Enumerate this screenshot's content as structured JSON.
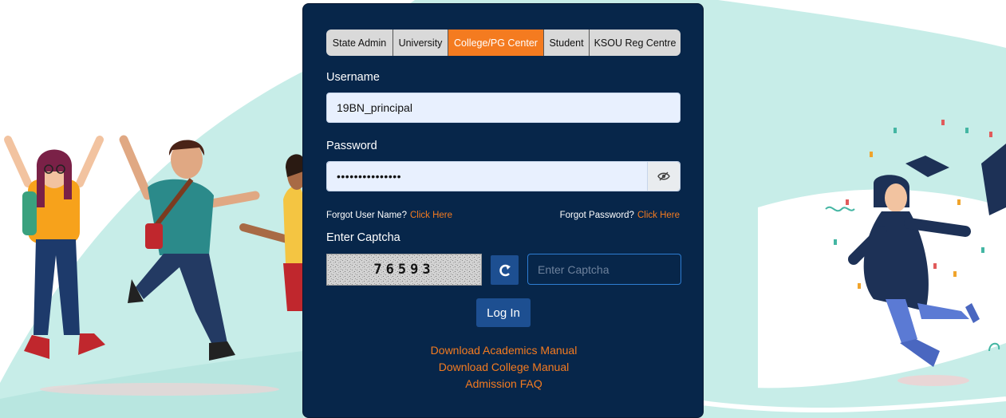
{
  "tabs": [
    {
      "label": "State Admin",
      "active": false
    },
    {
      "label": "University",
      "active": false
    },
    {
      "label": "College/PG Center",
      "active": true
    },
    {
      "label": "Student",
      "active": false
    },
    {
      "label": "KSOU Reg Centre",
      "active": false
    }
  ],
  "username": {
    "label": "Username",
    "value": "19BN_principal"
  },
  "password": {
    "label": "Password",
    "value": "•••••••••••••••",
    "toggle_icon": "eye-slash-icon"
  },
  "forgot_username": {
    "text": "Forgot User Name?",
    "link": "Click Here"
  },
  "forgot_password": {
    "text": "Forgot Password?",
    "link": "Click Here"
  },
  "captcha": {
    "label": "Enter Captcha",
    "code": "76593",
    "placeholder": "Enter Captcha",
    "refresh_icon": "refresh-icon"
  },
  "login_button": "Log In",
  "links": [
    "Download Academics Manual",
    "Download College Manual",
    "Admission FAQ"
  ],
  "colors": {
    "card": "#07264a",
    "accent": "#f47b20",
    "button": "#1d4f91",
    "backdrop": "#c7ede8"
  }
}
